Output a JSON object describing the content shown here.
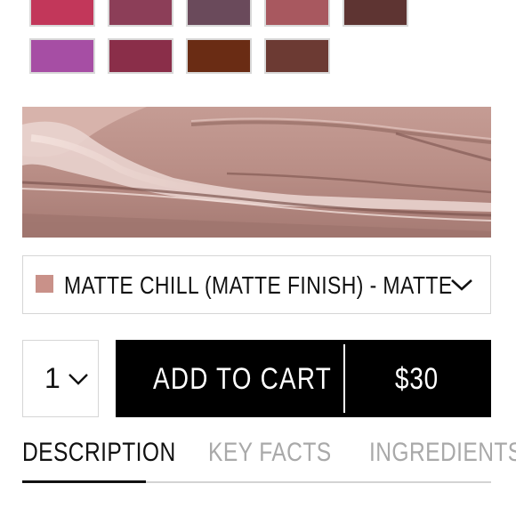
{
  "colors": {
    "swatches_row1": [
      "#c2375a",
      "#8c3e58",
      "#6a4a5b",
      "#a8585f",
      "#5e3432"
    ],
    "swatches_row2": [
      "#a64ea4",
      "#8a2e49",
      "#6a2c14",
      "#6c3a33"
    ],
    "selected_shade_chip": "#c99189",
    "add_to_cart_bg": "#000000"
  },
  "shade_select": {
    "label": "MATTE CHILL (MATTE FINISH) - MATTE",
    "chevron_icon": "chevron-down-icon"
  },
  "quantity": {
    "value": "1",
    "chevron_icon": "chevron-down-icon"
  },
  "add_to_cart": {
    "label": "ADD TO CART",
    "price": "$30"
  },
  "tabs": [
    {
      "label": "DESCRIPTION",
      "active": true
    },
    {
      "label": "KEY FACTS",
      "active": false
    },
    {
      "label": "INGREDIENTS",
      "active": false
    }
  ]
}
